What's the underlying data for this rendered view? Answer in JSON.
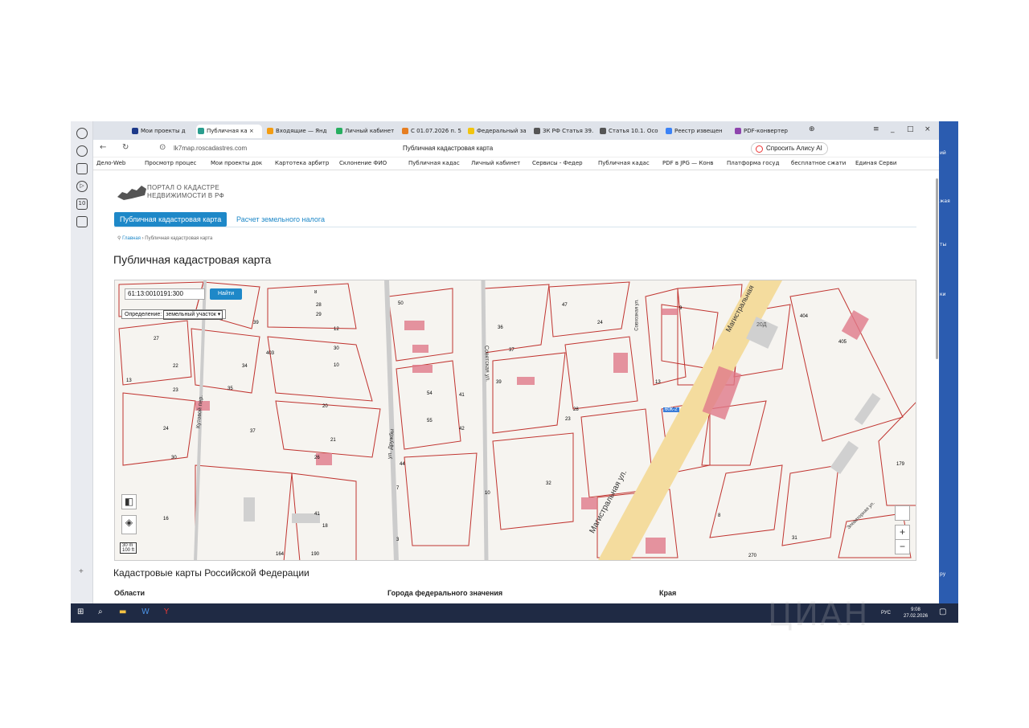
{
  "browser": {
    "tabs": [
      "Мои проекты д",
      "Публичная ка ×",
      "Входящие — Янд",
      "Личный кабинет",
      "С 01.07.2026 п. 5",
      "Федеральный за",
      "ЗК РФ Статья 39.",
      "Статья 10.1. Осо",
      "Реестр извещен",
      "PDF-конвертер"
    ],
    "url": "lk7map.roscadastres.com",
    "title": "Публичная кадастровая карта",
    "alisa": "Спросить Алису AI",
    "bookmarks": [
      "Дело-Web",
      "Просмотр процес",
      "Мои проекты док",
      "Картотека арбитр",
      "Склонение ФИО",
      "Публичная кадас",
      "Личный кабинет",
      "Сервисы - Федер",
      "Публичная кадас",
      "PDF в JPG — Конв",
      "Платформа госуд",
      "бесплатное сжати",
      "Единая Серви"
    ]
  },
  "portal": {
    "logo_line1": "ПОРТАЛ О КАДАСТРЕ",
    "logo_line2": "НЕДВИЖИМОСТИ В РФ",
    "nav_map": "Публичная кадастровая карта",
    "nav_tax": "Расчет земельного налога",
    "crumb_home": "Главная",
    "crumb_current": "Публичная кадастровая карта",
    "title": "Публичная кадастровая карта"
  },
  "map": {
    "search_value": "61:13:0010191:300",
    "find_label": "Найти",
    "def_label": "Определение:",
    "def_select": "земельный участок",
    "scale_m": "30 m",
    "scale_ft": "100 ft",
    "streets": [
      "ул. Дружбы",
      "Советская ул.",
      "Магистральная ул.",
      "Кутовой пер.",
      "Совхозная ул.",
      "Элеваторная ул.",
      "Магистральная",
      "60К-2"
    ],
    "numbers": [
      "8",
      "28",
      "29",
      "39",
      "12",
      "30",
      "10",
      "27",
      "22",
      "23",
      "24",
      "30",
      "13",
      "34",
      "35",
      "403",
      "37",
      "20",
      "21",
      "26",
      "41",
      "16",
      "18",
      "164",
      "190",
      "50",
      "54",
      "41",
      "55",
      "42",
      "44",
      "7",
      "3",
      "10",
      "36",
      "37",
      "39",
      "28",
      "23",
      "32",
      "47",
      "24",
      "13",
      "405",
      "404",
      "20Д",
      "179",
      "9",
      "8",
      "270",
      "31"
    ]
  },
  "section": {
    "title": "Кадастровые карты Российской Федерации",
    "col1": "Области",
    "col2": "Города федерального значения",
    "col3": "Края"
  },
  "taskbar": {
    "time": "9:08",
    "date": "27.02.2026",
    "lang": "РУС"
  },
  "watermark": "ЦИАН"
}
